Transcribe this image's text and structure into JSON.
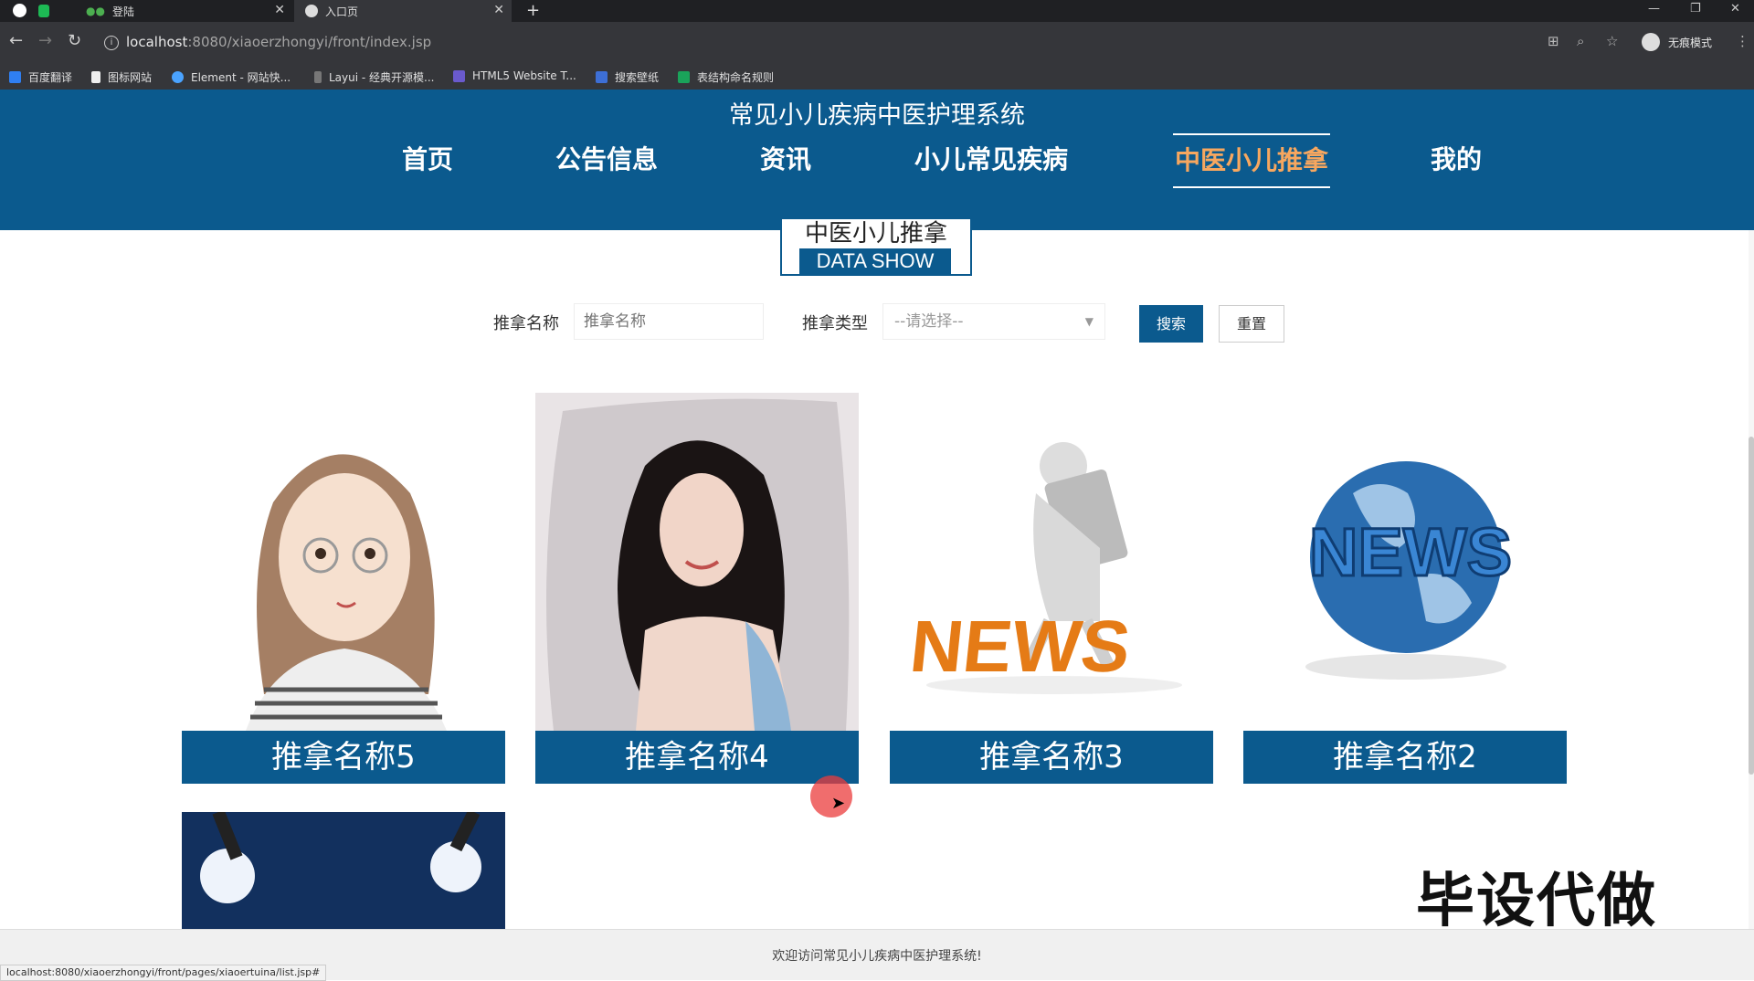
{
  "browser": {
    "tabs": [
      {
        "label": "",
        "icon": "green-app-icon"
      },
      {
        "label": "登陆",
        "icon": "dots-icon"
      },
      {
        "label": "入口页",
        "icon": "globe-icon",
        "active": true
      }
    ],
    "new_tab": "+",
    "url_host": "localhost",
    "url_path": ":8080/xiaoerzhongyi/front/index.jsp",
    "incognito_label": "无痕模式",
    "bookmarks": [
      "百度翻译",
      "图标网站",
      "Element - 网站快...",
      "Layui - 经典开源模...",
      "HTML5 Website T...",
      "搜索壁纸",
      "表结构命名规则"
    ]
  },
  "site": {
    "title": "常见小儿疾病中医护理系统",
    "nav": [
      "首页",
      "公告信息",
      "资讯",
      "小儿常见疾病",
      "中医小儿推拿",
      "我的"
    ],
    "active_nav": "中医小儿推拿"
  },
  "section": {
    "title_cn": "中医小儿推拿",
    "title_en": "DATA SHOW"
  },
  "search": {
    "name_label": "推拿名称",
    "name_placeholder": "推拿名称",
    "type_label": "推拿类型",
    "type_value": "--请选择--",
    "search_button": "搜索",
    "reset_button": "重置"
  },
  "cards": [
    {
      "label": "推拿名称5"
    },
    {
      "label": "推拿名称4"
    },
    {
      "label": "推拿名称3"
    },
    {
      "label": "推拿名称2"
    }
  ],
  "news_text_1": "NEWS",
  "news_text_2": "NEWS",
  "watermark": "毕设代做",
  "footer": "欢迎访问常见小儿疾病中医护理系统!",
  "status_url": "localhost:8080/xiaoerzhongyi/front/pages/xiaoertuina/list.jsp#",
  "colors": {
    "primary": "#0b5a8e",
    "active_nav": "#f7a75f"
  }
}
